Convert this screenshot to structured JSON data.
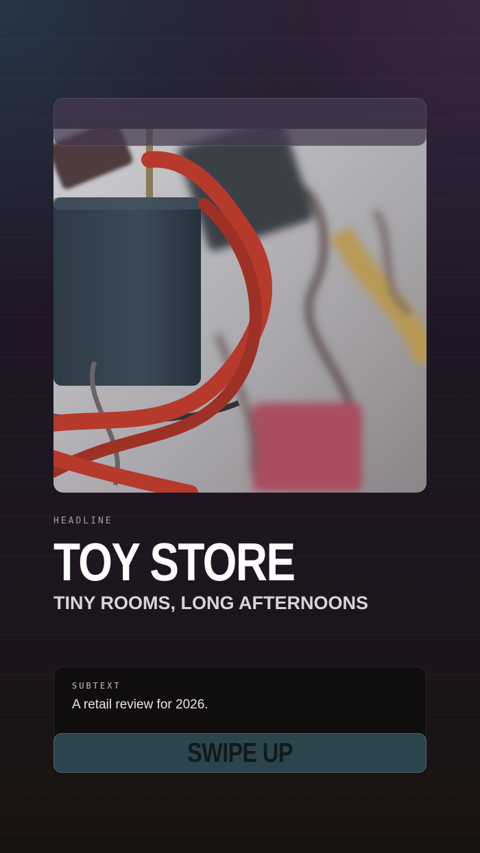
{
  "story": {
    "headline_label": "HEADLINE",
    "title": "TOY STORE",
    "subtitle": "TINY ROOMS, LONG AFTERNOONS",
    "subtext_label": "SUBTEXT",
    "subtext_body": "A retail review for 2026.",
    "cta_label": "SWIPE UP"
  },
  "media": {
    "icon": "padlocks-with-red-ribbon-photo"
  },
  "colors": {
    "accent": "#304e56",
    "background": "#221826",
    "ribbon": "#b43a2c"
  }
}
